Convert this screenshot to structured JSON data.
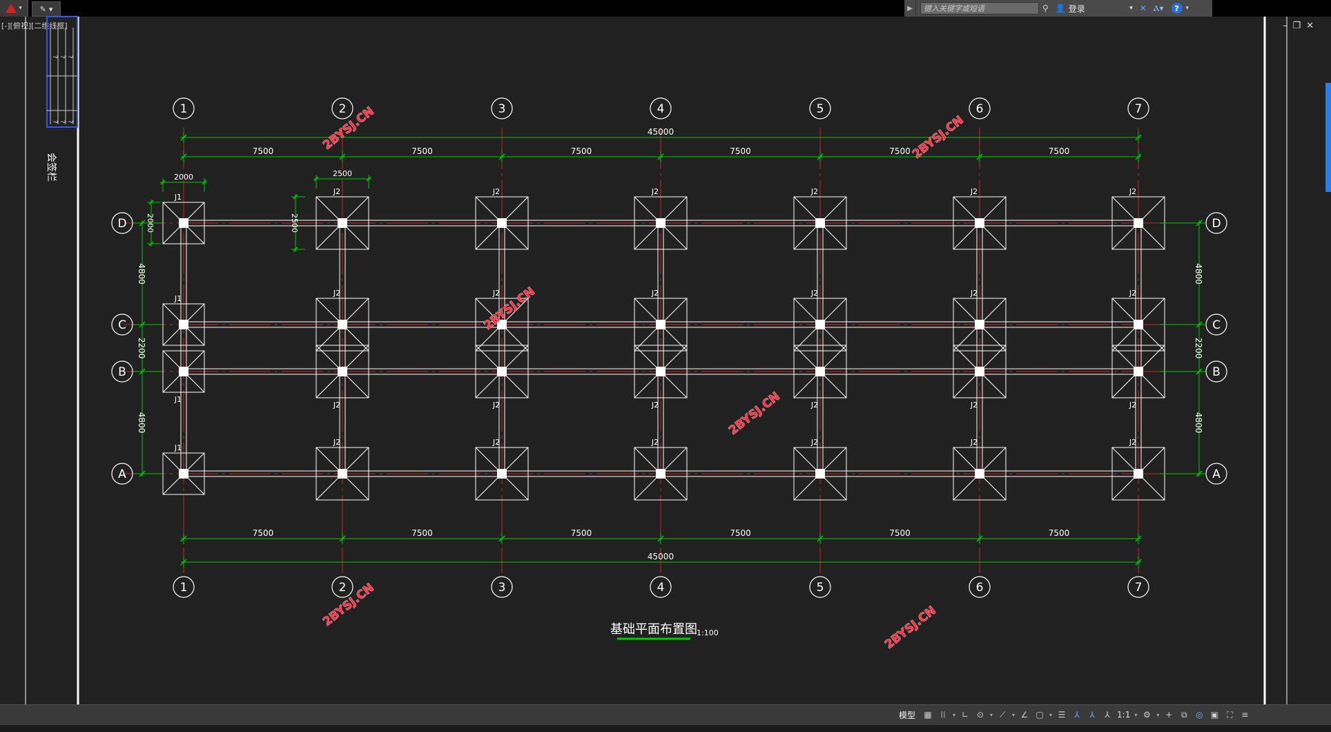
{
  "search": {
    "placeholder": "键入关键字或短语"
  },
  "user": {
    "login_label": "登录"
  },
  "viewport_label": "[-][俯视][二维线框]",
  "layout_tab": "会签栏",
  "countersign_marks": [
    "?",
    "?",
    "?",
    "?",
    "?",
    "?"
  ],
  "drawing": {
    "grid_columns": [
      "1",
      "2",
      "3",
      "4",
      "5",
      "6",
      "7"
    ],
    "grid_rows": [
      "D",
      "C",
      "B",
      "A"
    ],
    "bay_dimension": "7500",
    "total_dimension": "45000",
    "row_spacings": [
      "4800",
      "2200",
      "4800"
    ],
    "footing_dims": {
      "j1_width": "2000",
      "j2_width": "2500",
      "j1_height": "2000",
      "j2_height": "2500"
    },
    "footing_types": {
      "j1": "J1",
      "j2": "J2"
    },
    "title": "基础平面布置图",
    "scale": "1:100",
    "watermark": "2BYSJ.CN"
  },
  "statusbar": {
    "model_label": "模型",
    "annotation_scale": "1:1"
  },
  "colors": {
    "background": "#212121",
    "dimension": "#00cc00",
    "axis": "#cc2222",
    "watermark": "#ff3344",
    "accent": "#2e7ce0"
  }
}
